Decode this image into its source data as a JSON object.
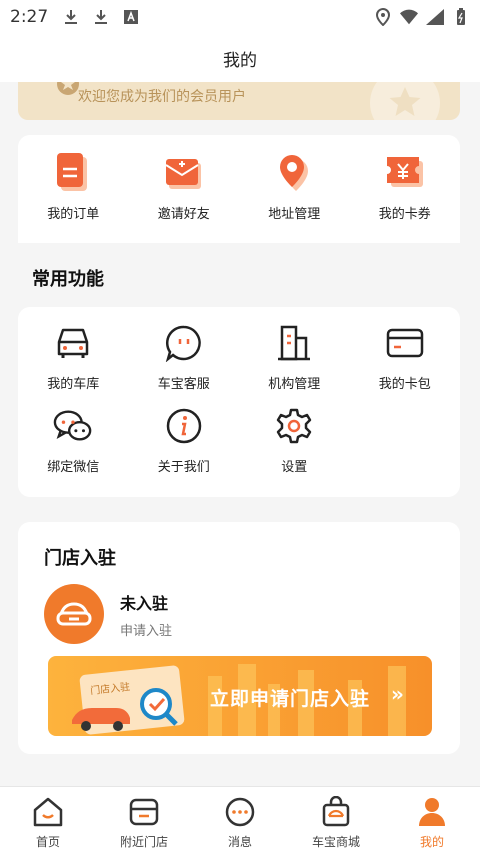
{
  "status_bar": {
    "time": "2:27"
  },
  "header": {
    "title": "我的"
  },
  "member_banner": {
    "text": "欢迎您成为我们的会员用户"
  },
  "quick_actions": [
    {
      "label": "我的订单",
      "icon": "order-icon"
    },
    {
      "label": "邀请好友",
      "icon": "invite-icon"
    },
    {
      "label": "地址管理",
      "icon": "location-icon"
    },
    {
      "label": "我的卡券",
      "icon": "coupon-icon"
    }
  ],
  "common_functions": {
    "heading": "常用功能",
    "items": [
      {
        "label": "我的车库",
        "icon": "car-icon"
      },
      {
        "label": "车宝客服",
        "icon": "chat-bubble-icon"
      },
      {
        "label": "机构管理",
        "icon": "building-icon"
      },
      {
        "label": "我的卡包",
        "icon": "card-icon"
      },
      {
        "label": "绑定微信",
        "icon": "wechat-icon"
      },
      {
        "label": "关于我们",
        "icon": "info-icon"
      },
      {
        "label": "设置",
        "icon": "gear-icon"
      }
    ]
  },
  "store": {
    "title": "门店入驻",
    "status": "未入驻",
    "subtitle": "申请入驻",
    "banner_cta": "立即申请门店入驻",
    "banner_arrow": "»",
    "banner_doc_label": "门店入驻"
  },
  "bottom_nav": [
    {
      "label": "首页",
      "icon": "home-icon"
    },
    {
      "label": "附近门店",
      "icon": "store-icon"
    },
    {
      "label": "消息",
      "icon": "message-icon"
    },
    {
      "label": "车宝商城",
      "icon": "shopping-bag-icon"
    },
    {
      "label": "我的",
      "icon": "profile-icon",
      "active": true
    }
  ],
  "colors": {
    "accent": "#f07a2b",
    "accent_light": "#fdb33d",
    "member_bg": "#f2e3c7",
    "member_text": "#b8935a"
  }
}
